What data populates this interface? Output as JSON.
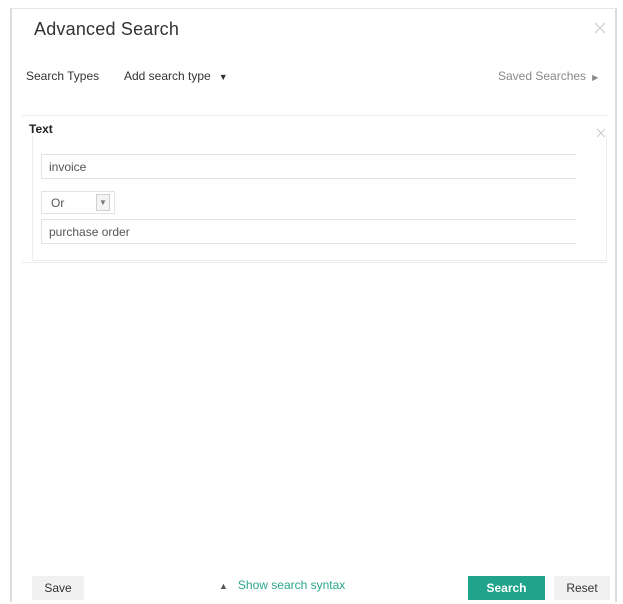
{
  "dialog": {
    "title": "Advanced Search"
  },
  "toolbar": {
    "search_types_label": "Search Types",
    "add_search_type_label": "Add search type",
    "saved_searches_label": "Saved Searches"
  },
  "text_panel": {
    "title": "Text",
    "terms": [
      {
        "value": "invoice"
      },
      {
        "value": "purchase order"
      }
    ],
    "operator": {
      "selected": "Or"
    }
  },
  "footer": {
    "save_label": "Save",
    "show_syntax_label": "Show search syntax",
    "search_label": "Search",
    "reset_label": "Reset"
  },
  "colors": {
    "accent": "#1fa38a",
    "link": "#2aa58b"
  },
  "icons": {
    "dialog_close": "close-icon",
    "panel_close": "close-icon",
    "add_type_caret": "caret-down-icon",
    "saved_arrow": "caret-right-icon",
    "operator_arrow": "chevron-down-icon",
    "syntax_chevron": "chevron-up-icon"
  }
}
